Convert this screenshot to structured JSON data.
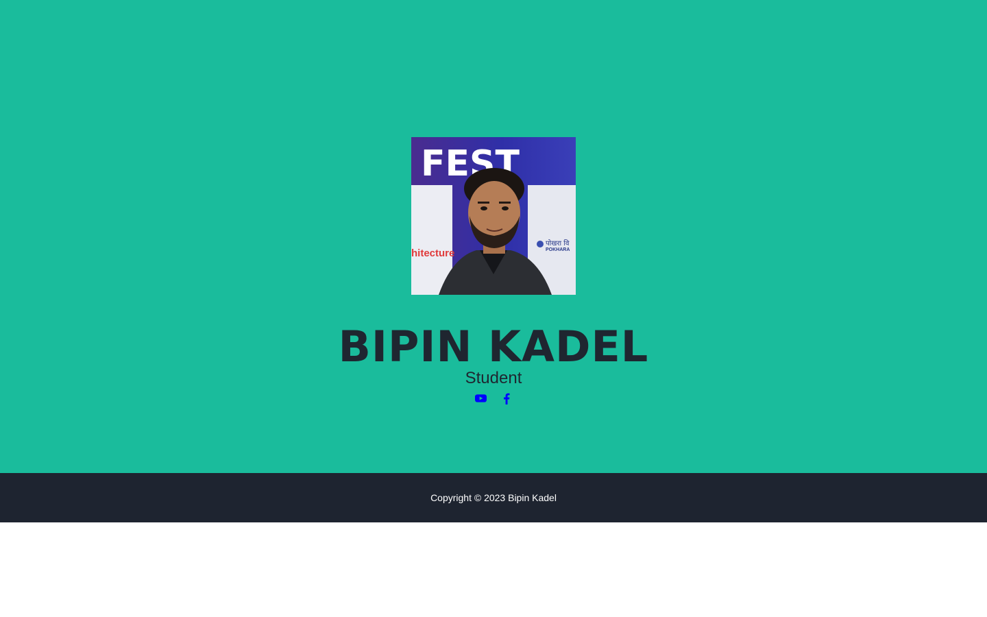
{
  "profile": {
    "name": "BIPIN KADEL",
    "subtitle": "Student",
    "photo_alt": "profile-photo"
  },
  "photo_text": {
    "banner_word": "FEST",
    "left_word": "hitecture",
    "right_lines": [
      "पोखरा वि",
      "POKHARA"
    ]
  },
  "social": [
    {
      "icon": "youtube-icon",
      "color": "#0000ff"
    },
    {
      "icon": "facebook-icon",
      "color": "#0000ff"
    }
  ],
  "footer": {
    "copyright": "Copyright © 2023 Bipin Kadel"
  },
  "colors": {
    "masthead_bg": "#1abc9c",
    "footer_bg": "#1e2430",
    "heading_text": "#1f2630",
    "icon_link": "#0000ff"
  }
}
